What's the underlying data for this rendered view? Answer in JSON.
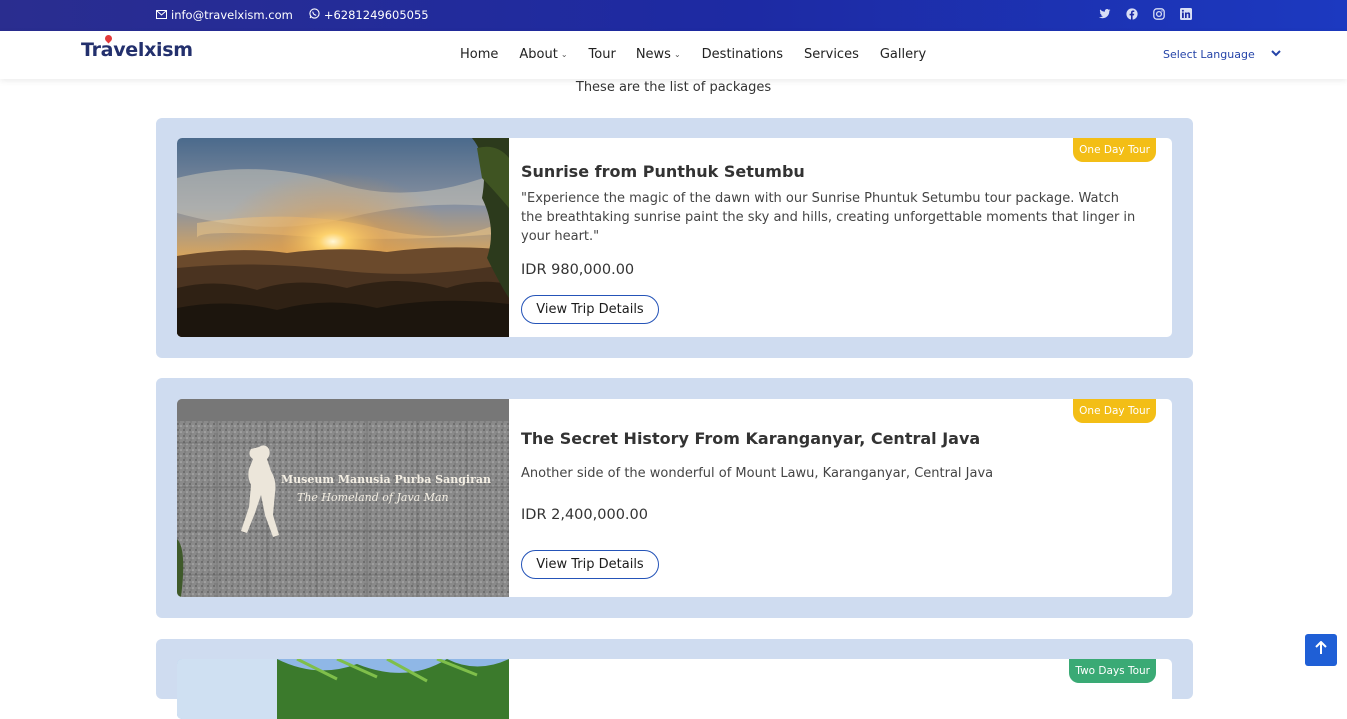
{
  "topbar": {
    "email": "info@travelxism.com",
    "phone": "+6281249605055",
    "social": [
      "twitter-icon",
      "facebook-icon",
      "instagram-icon",
      "linkedin-icon"
    ]
  },
  "nav": {
    "logo": "Travelxism",
    "items": [
      {
        "label": "Home"
      },
      {
        "label": "About"
      },
      {
        "label": "Tour"
      },
      {
        "label": "News"
      },
      {
        "label": "Destinations"
      },
      {
        "label": "Services"
      },
      {
        "label": "Gallery"
      }
    ],
    "language": "Select Language"
  },
  "intro": "These are the list of packages",
  "packages": [
    {
      "badge": "One Day Tour",
      "title": "Sunrise from Punthuk Setumbu",
      "description": "\"Experience the magic of the dawn with our Sunrise Phuntuk Setumbu tour package. Watch the breathtaking sunrise paint the sky and hills, creating unforgettable moments that linger in your heart.\"",
      "price": "IDR 980,000.00",
      "button": "View Trip Details"
    },
    {
      "badge": "One Day Tour",
      "title": "The Secret History From Karanganyar, Central Java",
      "description": "Another side of the wonderful of Mount Lawu, Karanganyar, Central Java",
      "price": "IDR 2,400,000.00",
      "button": "View Trip Details",
      "image_sign": [
        "Museum Manusia Purba Sangiran",
        "The Homeland of Java Man"
      ]
    },
    {
      "badge": "Two Days Tour"
    }
  ],
  "colors": {
    "accent": "#1f5fd6",
    "badge_yellow": "#f3be16",
    "badge_green": "#3aaa75",
    "card_bg": "#cfdcf0"
  }
}
